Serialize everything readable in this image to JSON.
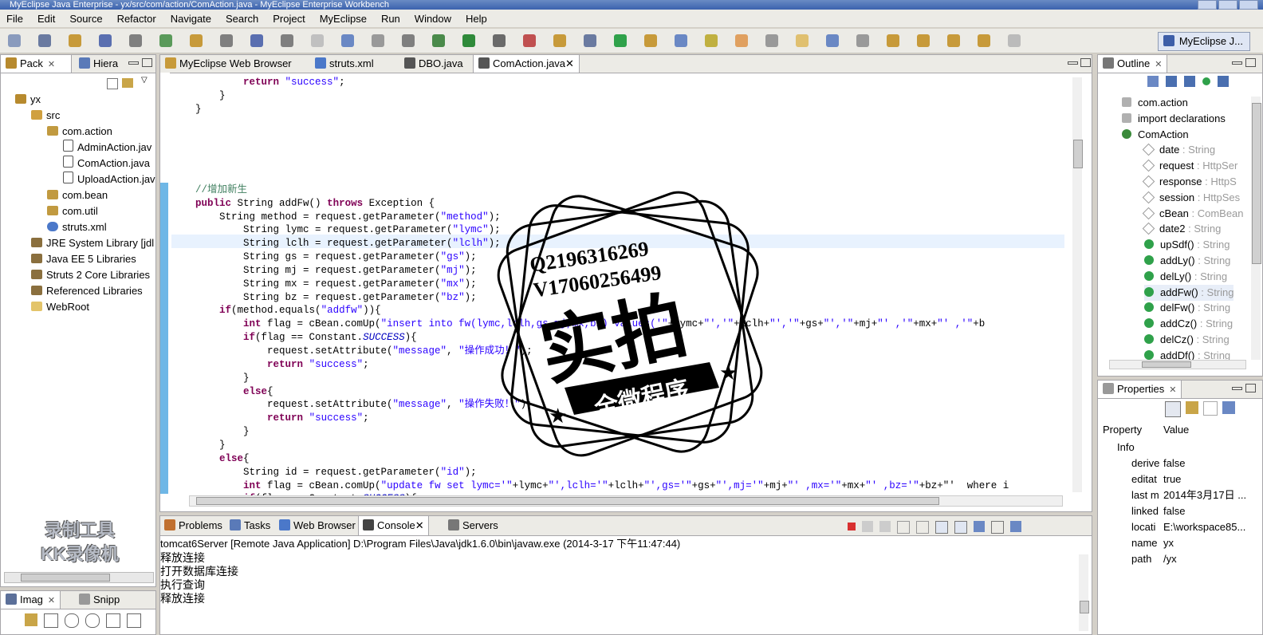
{
  "window": {
    "title": "MyEclipse Java Enterprise - yx/src/com/action/ComAction.java - MyEclipse Enterprise Workbench"
  },
  "menu": [
    "File",
    "Edit",
    "Source",
    "Refactor",
    "Navigate",
    "Search",
    "Project",
    "MyEclipse",
    "Run",
    "Window",
    "Help"
  ],
  "perspective": {
    "label": "MyEclipse J..."
  },
  "left_panel": {
    "tabs": [
      "Pack",
      "Hiera"
    ],
    "tree": [
      {
        "label": "yx",
        "icon": "project-icon"
      },
      {
        "label": "src",
        "icon": "package-folder-icon"
      },
      {
        "label": "com.action",
        "icon": "package-icon"
      },
      {
        "label": "AdminAction.jav",
        "icon": "java-file-icon"
      },
      {
        "label": "ComAction.java",
        "icon": "java-file-icon"
      },
      {
        "label": "UploadAction.jav",
        "icon": "java-file-icon"
      },
      {
        "label": "com.bean",
        "icon": "package-icon"
      },
      {
        "label": "com.util",
        "icon": "package-icon"
      },
      {
        "label": "struts.xml",
        "icon": "xml-file-icon"
      },
      {
        "label": "JRE System Library [jdl",
        "icon": "library-icon"
      },
      {
        "label": "Java EE 5 Libraries",
        "icon": "library-icon"
      },
      {
        "label": "Struts 2 Core Libraries",
        "icon": "library-icon"
      },
      {
        "label": "Referenced Libraries",
        "icon": "library-icon"
      },
      {
        "label": "WebRoot",
        "icon": "folder-icon"
      }
    ]
  },
  "bottom_left_panel": {
    "tabs": [
      "Imag",
      "Snipp"
    ]
  },
  "editor": {
    "tabs": [
      "MyEclipse Web Browser",
      "struts.xml",
      "DBO.java",
      "ComAction.java"
    ],
    "active_tab": "ComAction.java",
    "lines": [
      "            return \"success\";",
      "        }",
      "    }",
      "",
      "",
      "",
      "",
      "",
      "    //增加新生",
      "    public String addFw() throws Exception {",
      "        String method = request.getParameter(\"method\");",
      "            String lymc = request.getParameter(\"lymc\");",
      "            String lclh = request.getParameter(\"lclh\");",
      "            String gs = request.getParameter(\"gs\");",
      "            String mj = request.getParameter(\"mj\");",
      "            String mx = request.getParameter(\"mx\");",
      "            String bz = request.getParameter(\"bz\");",
      "        if(method.equals(\"addfw\")){",
      "            int flag = cBean.comUp(\"insert into fw(lymc,lclh,gs,mj,mx,bz) values('\"+lymc+\"','\"+lclh+\"','\"+gs+\"','\"+mj+\"' ,'\"+mx+\"' ,'\"+b",
      "            if(flag == Constant.SUCCESS){",
      "                request.setAttribute(\"message\", \"操作成功！\");",
      "                return \"success\";",
      "            }",
      "            else{",
      "                request.setAttribute(\"message\", \"操作失败！\");",
      "                return \"success\";",
      "            }",
      "        }",
      "        else{",
      "            String id = request.getParameter(\"id\");",
      "            int flag = cBean.comUp(\"update fw set lymc='\"+lymc+\"',lclh='\"+lclh+\"',gs='\"+gs+\"',mj='\"+mj+\"' ,mx='\"+mx+\"' ,bz='\"+bz+\"'  where i",
      "            if(flag == Constant.SUCCESS){"
    ]
  },
  "outline": {
    "tab": "Outline",
    "rows": [
      {
        "name": "com.action",
        "type": ""
      },
      {
        "name": "import declarations",
        "type": ""
      },
      {
        "name": "ComAction",
        "type": ""
      },
      {
        "name": "date",
        "type": " : String"
      },
      {
        "name": "request",
        "type": " : HttpSer"
      },
      {
        "name": "response",
        "type": " : HttpS"
      },
      {
        "name": "session",
        "type": " : HttpSes"
      },
      {
        "name": "cBean",
        "type": " : ComBean"
      },
      {
        "name": "date2",
        "type": " : String"
      },
      {
        "name": "upSdf()",
        "type": " : String"
      },
      {
        "name": "addLy()",
        "type": " : String"
      },
      {
        "name": "delLy()",
        "type": " : String"
      },
      {
        "name": "addFw()",
        "type": " : String"
      },
      {
        "name": "delFw()",
        "type": " : String"
      },
      {
        "name": "addCz()",
        "type": " : String"
      },
      {
        "name": "delCz()",
        "type": " : String"
      },
      {
        "name": "addDf()",
        "type": " : String"
      }
    ]
  },
  "properties": {
    "tab": "Properties",
    "headers": [
      "Property",
      "Value"
    ],
    "group": "Info",
    "rows": [
      {
        "key": "derive",
        "value": "false"
      },
      {
        "key": "editat",
        "value": "true"
      },
      {
        "key": "last m",
        "value": "2014年3月17日 ..."
      },
      {
        "key": "linked",
        "value": "false"
      },
      {
        "key": "locati",
        "value": "E:\\workspace85..."
      },
      {
        "key": "name",
        "value": "yx"
      },
      {
        "key": "path",
        "value": "/yx"
      }
    ]
  },
  "console": {
    "tabs": [
      "Problems",
      "Tasks",
      "Web Browser",
      "Console",
      "Servers"
    ],
    "header": "tomcat6Server [Remote Java Application] D:\\Program Files\\Java\\jdk1.6.0\\bin\\javaw.exe (2014-3-17 下午11:47:44)",
    "lines": [
      "释放连接",
      "打开数据库连接",
      "执行查询",
      "释放连接"
    ]
  },
  "watermark": {
    "line1": "录制工具",
    "line2": "KK录像机"
  },
  "stamp": {
    "qq": "Q2196316269",
    "wechat": "V17060256499",
    "main": "实拍",
    "banner": "全微程序"
  }
}
